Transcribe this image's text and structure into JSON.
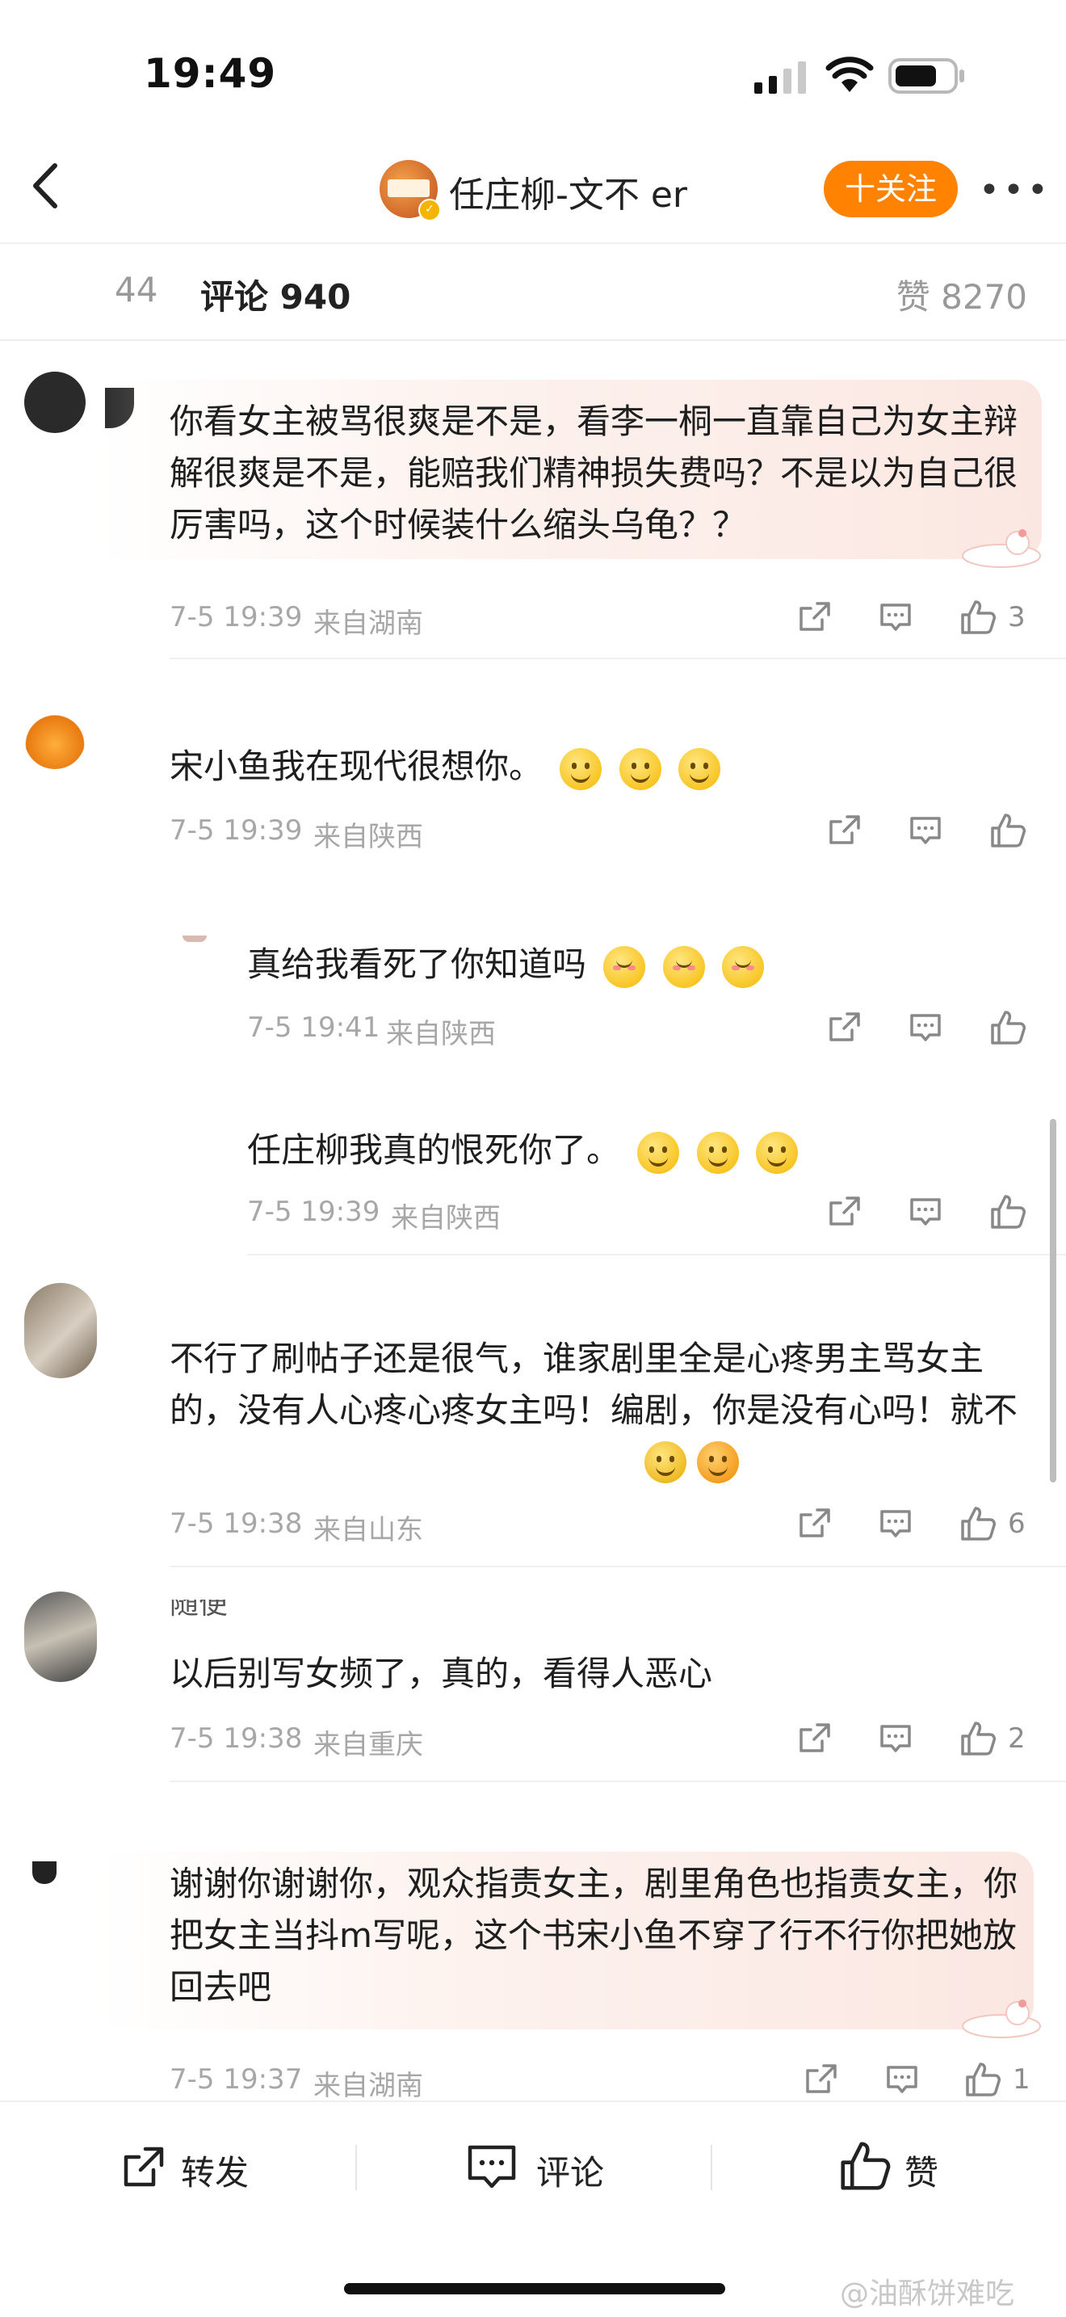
{
  "status_bar": {
    "time": "19:49"
  },
  "header": {
    "title": "任庄柳-文不 er",
    "follow_label": "十关注",
    "more_label": "•••"
  },
  "tabs": {
    "reposts": "44",
    "comments": "评论 940",
    "likes": "赞 8270"
  },
  "comments": [
    {
      "text": "你看女主被骂很爽是不是，看李一桐一直靠自己为女主辩解很爽是不是，能赔我们精神损失费吗？不是以为自己很厉害吗，这个时候装什么缩头乌龟？？",
      "time": "7-5 19:39",
      "location": "来自湖南",
      "likes": "3"
    },
    {
      "text": "宋小鱼我在现代很想你。",
      "time": "7-5 19:39",
      "location": "来自陕西",
      "likes": ""
    },
    {
      "text": "真给我看死了你知道吗",
      "time": "7-5 19:41",
      "location": "来自陕西",
      "likes": ""
    },
    {
      "text": "任庄柳我真的恨死你了。",
      "time": "7-5 19:39",
      "location": "来自陕西",
      "likes": ""
    },
    {
      "text": "不行了刷帖子还是很气，谁家剧里全是心疼男主骂女主的，没有人心疼心疼女主吗！编剧，你是没有心吗！就不爱你笔下的女主吗！",
      "time": "7-5 19:38",
      "location": "来自山东",
      "likes": "6"
    },
    {
      "text": "以后别写女频了，真的，看得人恶心",
      "time": "7-5 19:38",
      "location": "来自重庆",
      "likes": "2",
      "name_fragment": "随便"
    },
    {
      "text": "谢谢你谢谢你，观众指责女主，剧里角色也指责女主，你把女主当抖m写呢，这个书宋小鱼不穿了行不行你把她放回去吧",
      "time": "7-5 19:37",
      "location": "来自湖南",
      "likes": "1"
    }
  ],
  "bottom_bar": {
    "repost": "转发",
    "comment": "评论",
    "like": "赞"
  },
  "watermark": "@油酥饼难吃",
  "colors": {
    "accent": "#ff8200",
    "meta": "#a7a7a7",
    "bubble": "#fbe7e2"
  }
}
